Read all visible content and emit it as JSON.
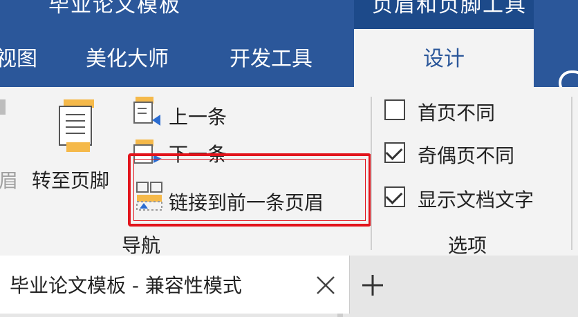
{
  "titlebar": {
    "doc_title": "毕业论文模板",
    "context_title": "页眉和页脚工具"
  },
  "tabs": [
    {
      "label": "视图"
    },
    {
      "label": "美化大师"
    },
    {
      "label": "开发工具"
    },
    {
      "label": "设计"
    }
  ],
  "ribbon": {
    "partial_header_label": "眉",
    "goto_footer_label": "转至页脚",
    "previous_label": "上一条",
    "next_label": "下一条",
    "link_previous_label": "链接到前一条页眉",
    "navigation_group_label": "导航",
    "options_group_label": "选项",
    "options": [
      {
        "label": "首页不同",
        "checked": false
      },
      {
        "label": "奇偶页不同",
        "checked": true
      },
      {
        "label": "显示文档文字",
        "checked": true
      }
    ]
  },
  "doc_tab": {
    "label": "毕业论文模板  -  兼容性模式",
    "close_icon": "close-icon",
    "add_icon": "plus-icon"
  },
  "colors": {
    "accent": "#2b579a",
    "highlight": "#e2141c",
    "icon_orange": "#f5b94a",
    "icon_blue": "#2b6cd1"
  }
}
